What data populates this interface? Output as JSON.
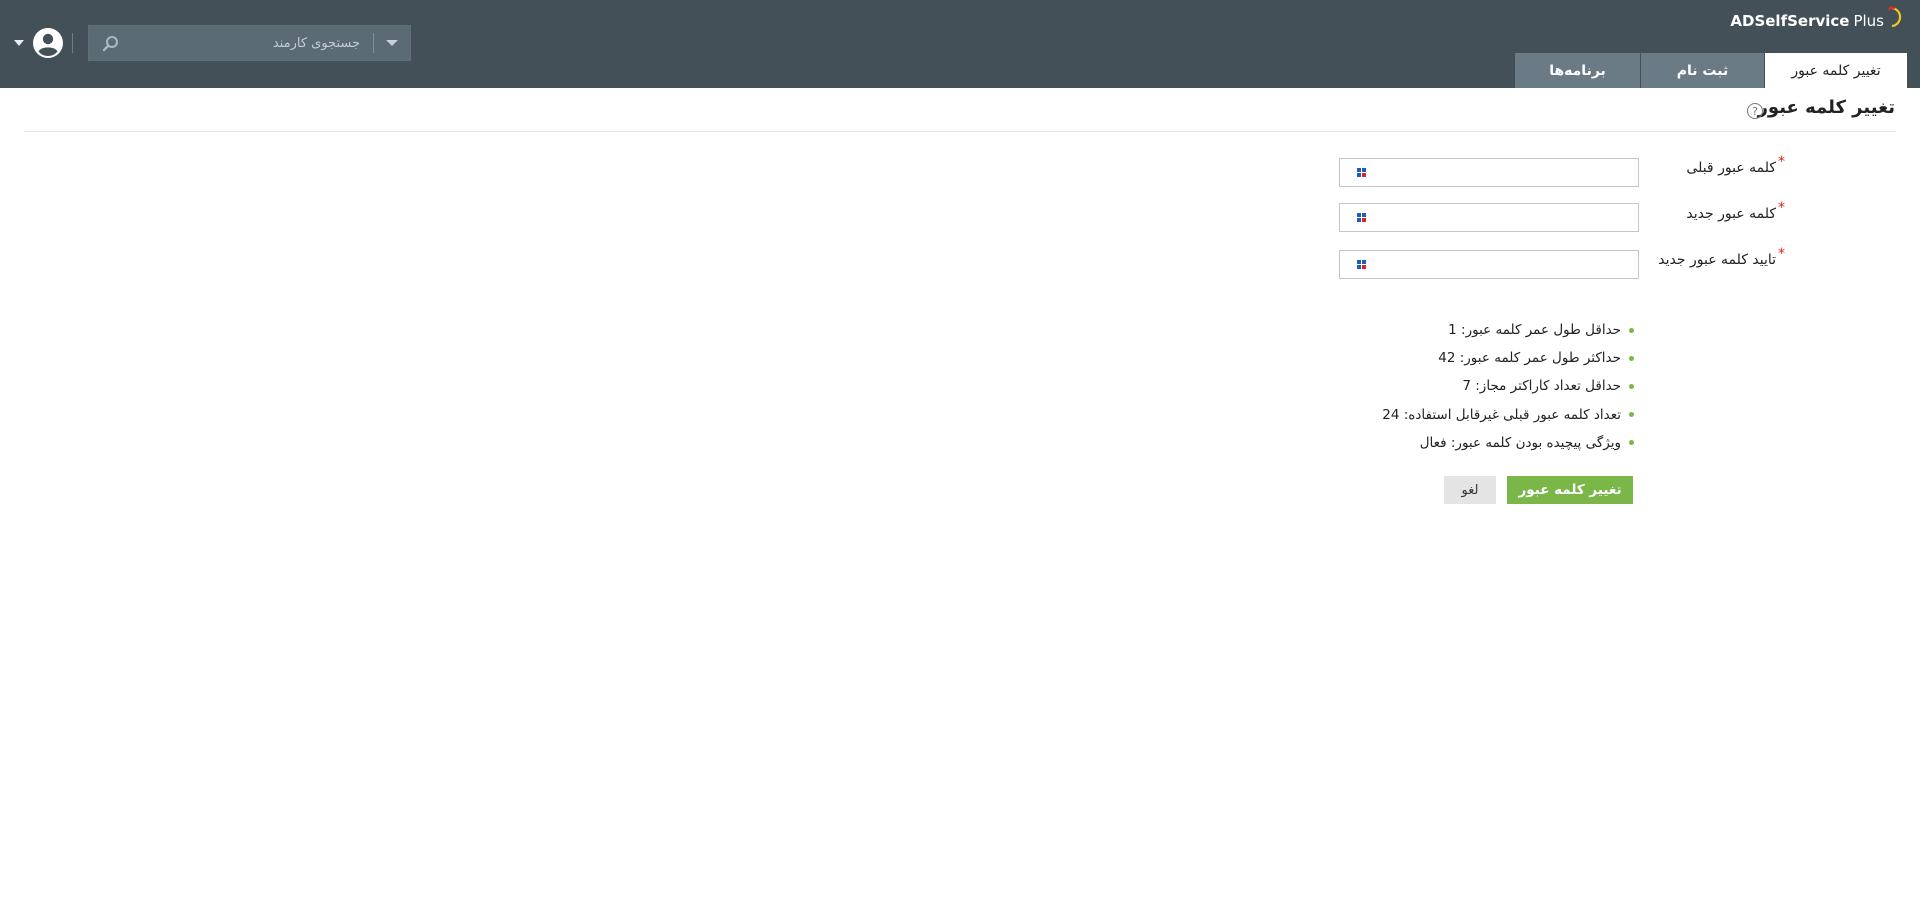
{
  "app": {
    "brand_primary": "ADSelfService",
    "brand_secondary": "Plus",
    "logo_icon": "arc-logo-icon",
    "header_color": "#435058",
    "accent_color": "#7ab648"
  },
  "tabs": [
    {
      "label": "تغییر کلمه عبور",
      "active": true
    },
    {
      "label": "ثبت نام",
      "active": false
    },
    {
      "label": "برنامه‌ها",
      "active": false
    }
  ],
  "search": {
    "placeholder": "جستجوی کارمند",
    "value": "",
    "icon": "search-icon",
    "dropdown_icon": "chevron-down-icon"
  },
  "user": {
    "icon": "user-avatar-icon",
    "menu_icon": "caret-down-icon"
  },
  "page": {
    "title": "تغییر کلمه عبور",
    "help_symbol": "?"
  },
  "form": {
    "required_mark": "*",
    "fields": [
      {
        "label": "کلمه عبور قبلی",
        "value": ""
      },
      {
        "label": "کلمه عبور جدید",
        "value": ""
      },
      {
        "label": "تایید کلمه عبور جدید",
        "value": ""
      }
    ],
    "field_icon": "password-manager-icon"
  },
  "policy": [
    "حداقل طول عمر کلمه عبور: 1",
    "حداکثر طول عمر کلمه عبور: 42",
    "حداقل تعداد کاراکتر مجاز: 7",
    "تعداد کلمه عبور قبلی غیرقابل استفاده: 24",
    "ویژگی پیچیده بودن کلمه عبور: فعال"
  ],
  "buttons": {
    "submit": "تغییر کلمه عبور",
    "cancel": "لغو"
  }
}
